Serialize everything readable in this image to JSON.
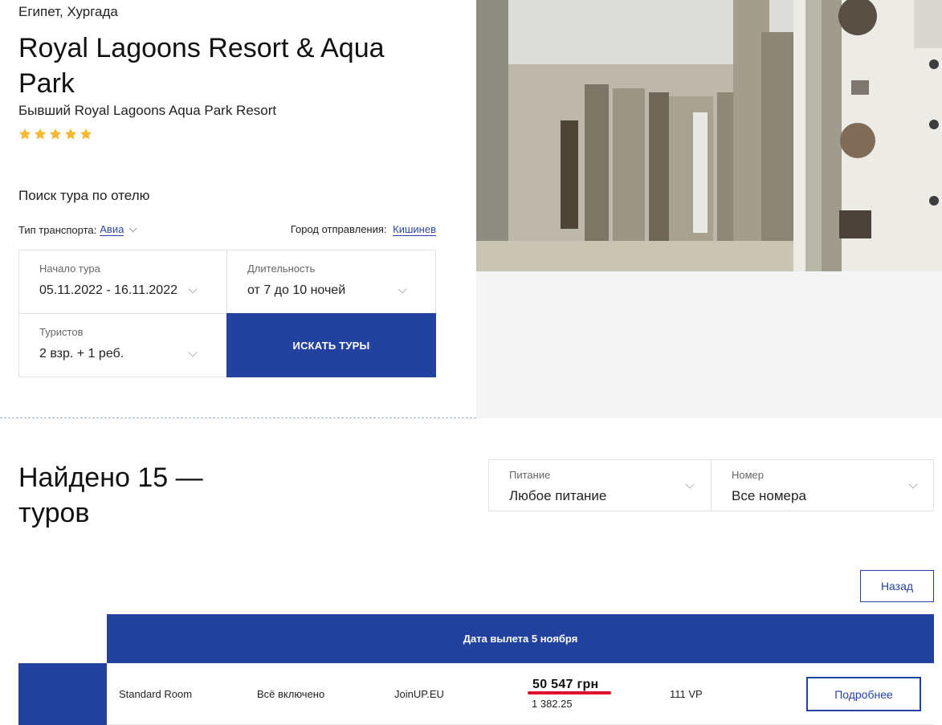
{
  "hotel": {
    "location": "Египет, Хургада",
    "title": "Royal Lagoons Resort & Aqua Park",
    "former_name": "Бывший Royal Lagoons Aqua Park Resort",
    "stars": 5,
    "star_color": "#f5b82e"
  },
  "search": {
    "title": "Поиск тура по отелю",
    "transport_label": "Тип транспорта:",
    "transport_value": "Авиа",
    "city_label": "Город отправления:",
    "city_value": "Кишинев",
    "start_label": "Начало тура",
    "start_value": "05.11.2022 - 16.11.2022",
    "duration_label": "Длительность",
    "duration_value": "от 7 до 10 ночей",
    "tourists_label": "Туристов",
    "tourists_value": "2 взр. + 1 реб.",
    "search_button": "ИСКАТЬ ТУРЫ"
  },
  "results": {
    "found_text": "Найдено 15 — туров",
    "food_label": "Питание",
    "food_value": "Любое питание",
    "room_label": "Номер",
    "room_value": "Все номера",
    "back_button": "Назад",
    "date_header": "Дата вылета 5 ноября",
    "rows": [
      {
        "room": "Standard Room",
        "meal": "Всё включено",
        "operator": "JoinUP.EU",
        "price": "50 547 грн",
        "price_alt": "1 382.25",
        "flight": "111 VP",
        "details_button": "Подробнее"
      }
    ]
  },
  "colors": {
    "accent": "#2342a0",
    "link": "#2b48a6",
    "highlight": "#e0102a"
  }
}
